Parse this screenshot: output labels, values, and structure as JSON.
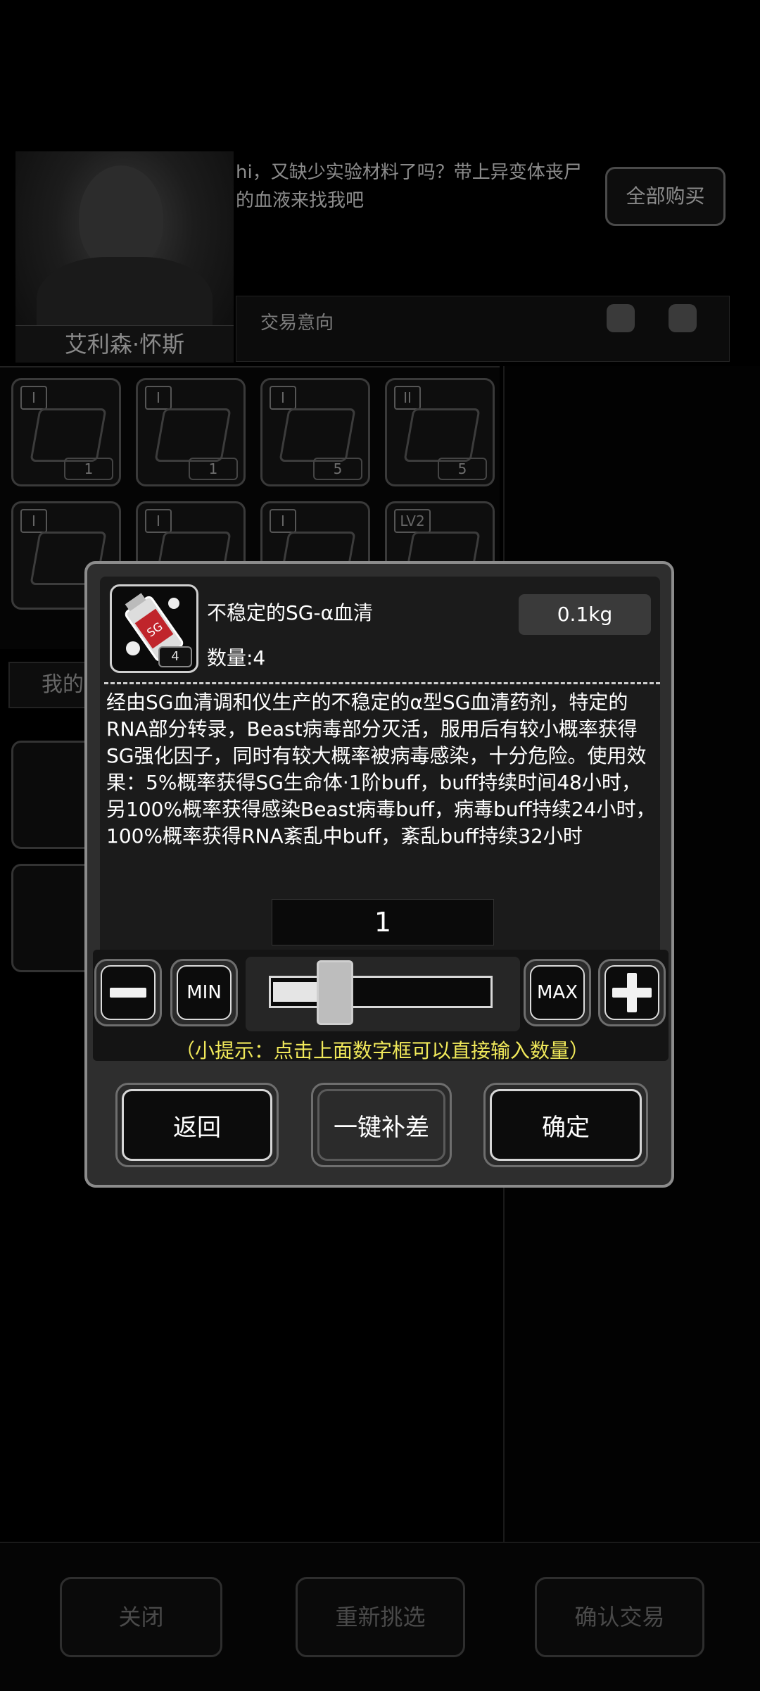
{
  "npc": {
    "name": "艾利森·怀斯",
    "dialog": "hi，又缺少实验材料了吗？带上异变体丧尸的血液来找我吧",
    "buy_all_label": "全部购买",
    "trade_intent_label": "交易意向"
  },
  "shop_grid": {
    "counts": [
      "1",
      "1",
      "5",
      "5"
    ],
    "tier_labels": [
      "I",
      "I",
      "I",
      "II",
      "I",
      "I",
      "I",
      "LV2"
    ]
  },
  "my_tab_label": "我的",
  "bottom_bar": {
    "close_label": "关闭",
    "reselect_label": "重新挑选",
    "confirm_trade_label": "确认交易"
  },
  "modal": {
    "item_name": "不稳定的SG-α血清",
    "quantity_label": "数量:4",
    "icon_badge": "4",
    "weight": "0.1kg",
    "description": "经由SG血清调和仪生产的不稳定的α型SG血清药剂，特定的RNA部分转录，Beast病毒部分灭活，服用后有较小概率获得SG强化因子，同时有较大概率被病毒感染，十分危险。使用效果：5%概率获得SG生命体·1阶buff，buff持续时间48小时，另100%概率获得感染Beast病毒buff，病毒buff持续24小时，100%概率获得RNA紊乱中buff，紊乱buff持续32小时",
    "selected_quantity": "1",
    "min_label": "MIN",
    "max_label": "MAX",
    "slider_fraction": 0.25,
    "hint": "（小提示：点击上面数字框可以直接输入数量）",
    "back_label": "返回",
    "fill_gap_label": "一键补差",
    "confirm_label": "确定"
  },
  "colors": {
    "hint": "#f0e85a",
    "modal_bg": "#2e2e2e",
    "modal_border": "#8c8c8c"
  }
}
